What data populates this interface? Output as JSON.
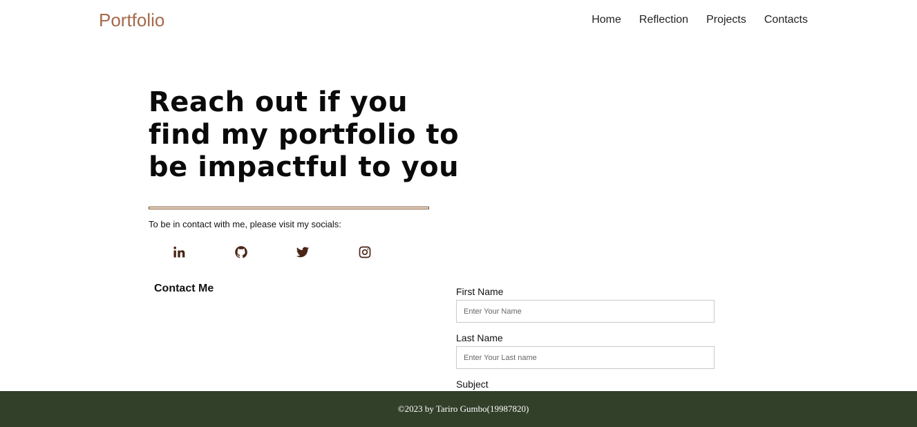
{
  "brand": "Portfolio",
  "nav": [
    "Home",
    "Reflection",
    "Projects",
    "Contacts"
  ],
  "hero": {
    "headline": "Reach out if you find my portfolio to be impactful to you",
    "socials_text": "To be in contact with me, please visit my socials:"
  },
  "socials": [
    {
      "icon": "linkedin-icon"
    },
    {
      "icon": "github-icon"
    },
    {
      "icon": "twitter-icon"
    },
    {
      "icon": "instagram-icon"
    }
  ],
  "contact": {
    "heading": "Contact Me",
    "first_name_label": "First Name",
    "first_name_placeholder": "Enter Your Name",
    "last_name_label": "Last Name",
    "last_name_placeholder": "Enter Your Last name",
    "subject_label": "Subject"
  },
  "footer": "©2023 by Tariro Gumbo(19987820)",
  "colors": {
    "brand": "#a5694a",
    "icon": "#4a2415",
    "footer_bg": "#323f29",
    "divider": "#7a4a24"
  }
}
